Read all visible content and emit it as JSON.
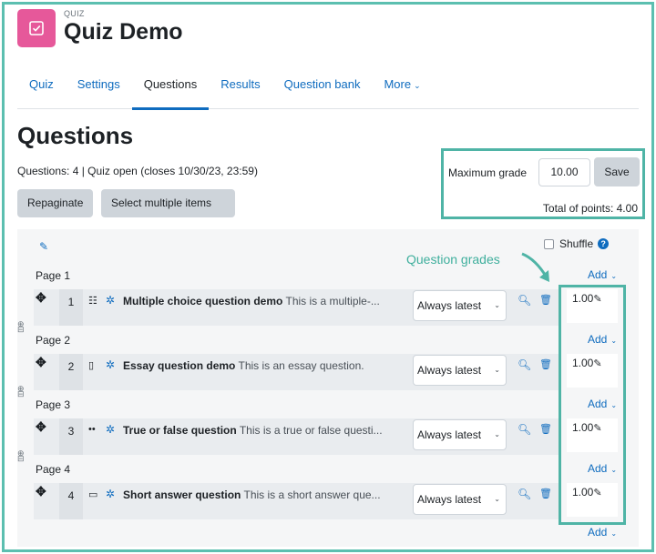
{
  "header": {
    "context_label": "QUIZ",
    "title": "Quiz Demo",
    "icon": "quiz-checkbox-icon",
    "icon_color": "#e6589a"
  },
  "nav": {
    "tabs": [
      {
        "label": "Quiz"
      },
      {
        "label": "Settings"
      },
      {
        "label": "Questions",
        "active": true
      },
      {
        "label": "Results"
      },
      {
        "label": "Question bank"
      },
      {
        "label": "More"
      }
    ]
  },
  "questions_page": {
    "title": "Questions",
    "status": "Questions: 4 | Quiz open (closes 10/30/23, 23:59)",
    "repaginate_label": "Repaginate",
    "select_multiple_label": "Select multiple items",
    "maximum_grade_label": "Maximum grade",
    "maximum_grade_value": "10.00",
    "save_label": "Save",
    "total_points": "Total of points: 4.00",
    "shuffle_label": "Shuffle",
    "annotation": "Question grades",
    "add_label": "Add"
  },
  "pages": [
    {
      "label": "Page 1",
      "question": {
        "number": "1",
        "type_icon": "list-icon",
        "name": "Multiple choice question demo",
        "text": "This is a multiple-...",
        "version": "Always latest",
        "mark": "1.00"
      }
    },
    {
      "label": "Page 2",
      "question": {
        "number": "2",
        "type_icon": "essay-icon",
        "name": "Essay question demo",
        "text": "This is an essay question.",
        "version": "Always latest",
        "mark": "1.00"
      }
    },
    {
      "label": "Page 3",
      "question": {
        "number": "3",
        "type_icon": "truefalse-icon",
        "name": "True or false question",
        "text": "This is a true or false questi...",
        "version": "Always latest",
        "mark": "1.00"
      }
    },
    {
      "label": "Page 4",
      "question": {
        "number": "4",
        "type_icon": "shortanswer-icon",
        "name": "Short answer question",
        "text": "This is a short answer que...",
        "version": "Always latest",
        "mark": "1.00"
      }
    }
  ],
  "colors": {
    "accent": "#0f6cbf",
    "annotation": "#4fb4a6"
  }
}
